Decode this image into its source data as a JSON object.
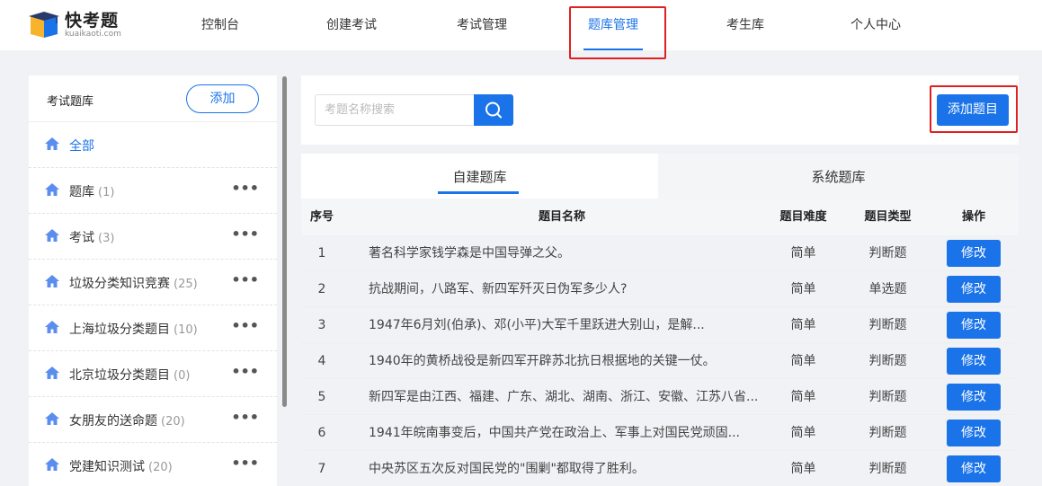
{
  "brand": {
    "title": "快考题",
    "subtitle": "kuaikaoti.com"
  },
  "nav": [
    {
      "label": "控制台"
    },
    {
      "label": "创建考试"
    },
    {
      "label": "考试管理"
    },
    {
      "label": "题库管理",
      "active": true
    },
    {
      "label": "考生库"
    },
    {
      "label": "个人中心"
    }
  ],
  "sidebar": {
    "title": "考试题库",
    "add_label": "添加",
    "items": [
      {
        "label": "全部",
        "count": "",
        "active": true
      },
      {
        "label": "题库",
        "count": "(1)"
      },
      {
        "label": "考试",
        "count": "(3)"
      },
      {
        "label": "垃圾分类知识竞赛",
        "count": "(25)"
      },
      {
        "label": "上海垃圾分类题目",
        "count": "(10)"
      },
      {
        "label": "北京垃圾分类题目",
        "count": "(0)"
      },
      {
        "label": "女朋友的送命题",
        "count": "(20)"
      },
      {
        "label": "党建知识测试",
        "count": "(20)"
      }
    ],
    "more_glyph": "•••"
  },
  "search": {
    "placeholder": "考题名称搜索",
    "value": ""
  },
  "add_question_label": "添加题目",
  "tabs": [
    {
      "label": "自建题库",
      "active": true
    },
    {
      "label": "系统题库"
    }
  ],
  "table": {
    "headers": {
      "no": "序号",
      "name": "题目名称",
      "difficulty": "题目难度",
      "type": "题目类型",
      "op": "操作"
    },
    "edit_label": "修改",
    "rows": [
      {
        "no": "1",
        "name": "著名科学家钱学森是中国导弹之父。",
        "difficulty": "简单",
        "type": "判断题"
      },
      {
        "no": "2",
        "name": "抗战期间，八路军、新四军歼灭日伪军多少人?",
        "difficulty": "简单",
        "type": "单选题"
      },
      {
        "no": "3",
        "name": "1947年6月刘(伯承)、邓(小平)大军千里跃进大别山，是解...",
        "difficulty": "简单",
        "type": "判断题"
      },
      {
        "no": "4",
        "name": "1940年的黄桥战役是新四军开辟苏北抗日根据地的关键一仗。",
        "difficulty": "简单",
        "type": "判断题"
      },
      {
        "no": "5",
        "name": "新四军是由江西、福建、广东、湖北、湖南、浙江、安徽、江苏八省...",
        "difficulty": "简单",
        "type": "判断题"
      },
      {
        "no": "6",
        "name": "1941年皖南事变后，中国共产党在政治上、军事上对国民党顽固...",
        "difficulty": "简单",
        "type": "判断题"
      },
      {
        "no": "7",
        "name": "中央苏区五次反对国民党的\"围剿\"都取得了胜利。",
        "difficulty": "简单",
        "type": "判断题"
      }
    ]
  },
  "colors": {
    "accent": "#1a73e8",
    "highlight": "#e02020"
  }
}
